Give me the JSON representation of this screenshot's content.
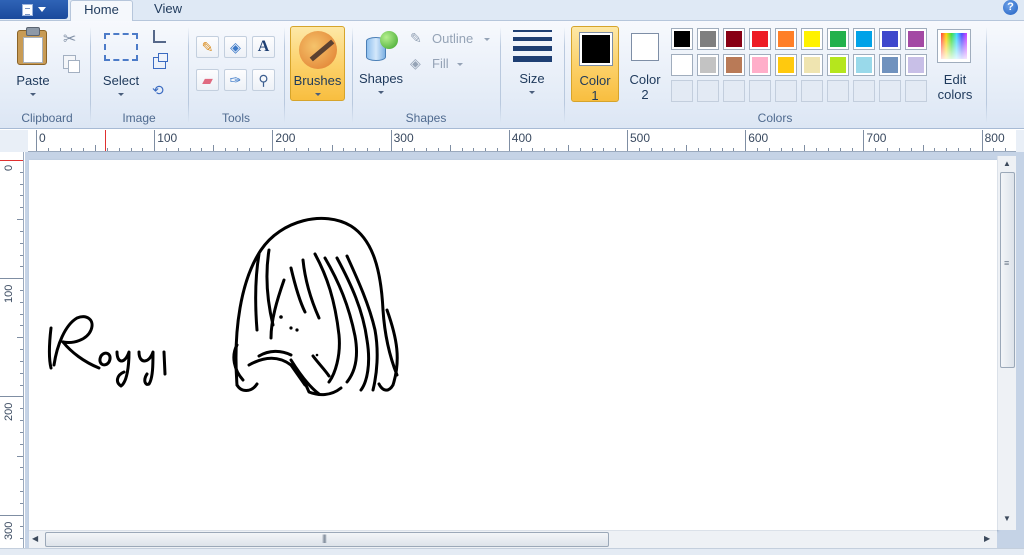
{
  "tabs": {
    "home": "Home",
    "view": "View"
  },
  "help": "?",
  "clipboard": {
    "paste": "Paste",
    "group": "Clipboard"
  },
  "image": {
    "select": "Select",
    "group": "Image"
  },
  "tools": {
    "group": "Tools"
  },
  "brushes": {
    "label": "Brushes"
  },
  "shapes": {
    "label": "Shapes",
    "outline": "Outline",
    "fill": "Fill",
    "group": "Shapes"
  },
  "size": {
    "label": "Size"
  },
  "colors": {
    "color1_label": "Color",
    "color1_num": "1",
    "color2_label": "Color",
    "color2_num": "2",
    "edit_label": "Edit",
    "edit_label2": "colors",
    "group": "Colors",
    "color1_value": "#000000",
    "color2_value": "#ffffff",
    "row1": [
      "#000000",
      "#7f7f7f",
      "#880015",
      "#ed1c24",
      "#ff7f27",
      "#fff200",
      "#22b14c",
      "#00a2e8",
      "#3f48cc",
      "#a349a4"
    ],
    "row2": [
      "#ffffff",
      "#c3c3c3",
      "#b97a57",
      "#ffaec9",
      "#ffc90e",
      "#efe4b0",
      "#b5e61d",
      "#99d9ea",
      "#7092be",
      "#c8bfe7"
    ]
  },
  "ruler": {
    "h": [
      "0",
      "100",
      "200",
      "300",
      "400",
      "500",
      "600",
      "700",
      "800"
    ],
    "v": [
      "0",
      "100",
      "200",
      "300"
    ]
  }
}
